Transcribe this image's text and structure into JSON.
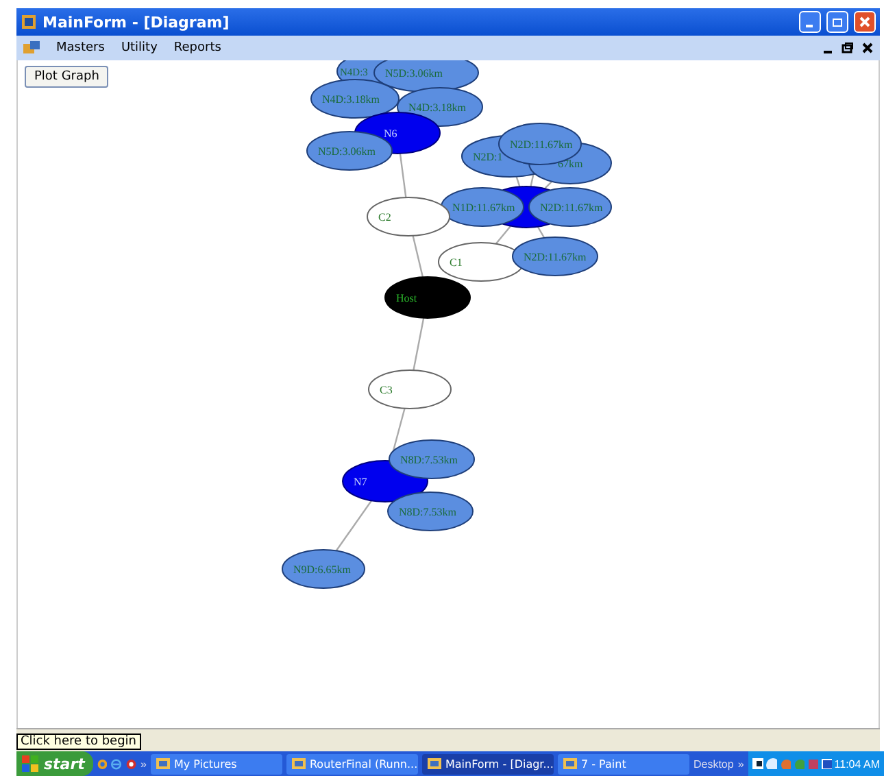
{
  "window": {
    "title": "MainForm - [Diagram]"
  },
  "menu": [
    "Masters",
    "Utility",
    "Reports"
  ],
  "plot_button": "Plot Graph",
  "graph": {
    "nodes": [
      {
        "label": "N4D:3",
        "kind": "distance"
      },
      {
        "label": "N5D:3.06km",
        "kind": "distance"
      },
      {
        "label": "N4D:3.18km",
        "kind": "distance"
      },
      {
        "label": "N4D:3.18km",
        "kind": "distance"
      },
      {
        "label": "N6",
        "kind": "router"
      },
      {
        "label": "N5D:3.06km",
        "kind": "distance"
      },
      {
        "label": "N2D:1",
        "kind": "distance"
      },
      {
        "label": "N2D:11.67km",
        "kind": "distance"
      },
      {
        "label": "67km",
        "kind": "distance"
      },
      {
        "kind": "router"
      },
      {
        "label": "N1D:11.67km",
        "kind": "distance"
      },
      {
        "label": "N2D:11.67km",
        "kind": "distance"
      },
      {
        "label": "C2",
        "kind": "client"
      },
      {
        "label": "C1",
        "kind": "client"
      },
      {
        "label": "N2D:11.67km",
        "kind": "distance"
      },
      {
        "label": "Host",
        "kind": "host"
      },
      {
        "label": "C3",
        "kind": "client"
      },
      {
        "label": "N7",
        "kind": "router"
      },
      {
        "label": "N8D:7.53km",
        "kind": "distance"
      },
      {
        "label": "N8D:7.53km",
        "kind": "distance"
      },
      {
        "label": "N9D:6.65km",
        "kind": "distance"
      }
    ]
  },
  "tooltip": "Click here to begin",
  "taskbar": {
    "start": "start",
    "chevron": "»",
    "tasks": [
      {
        "label": "My Pictures",
        "selected": false
      },
      {
        "label": "RouterFinal (Runn...",
        "selected": false
      },
      {
        "label": "MainForm - [Diagr...",
        "selected": true
      },
      {
        "label": "7 - Paint",
        "selected": false
      }
    ],
    "desktop": "Desktop",
    "desktop_chevron": "»",
    "clock": "11:04 AM"
  }
}
